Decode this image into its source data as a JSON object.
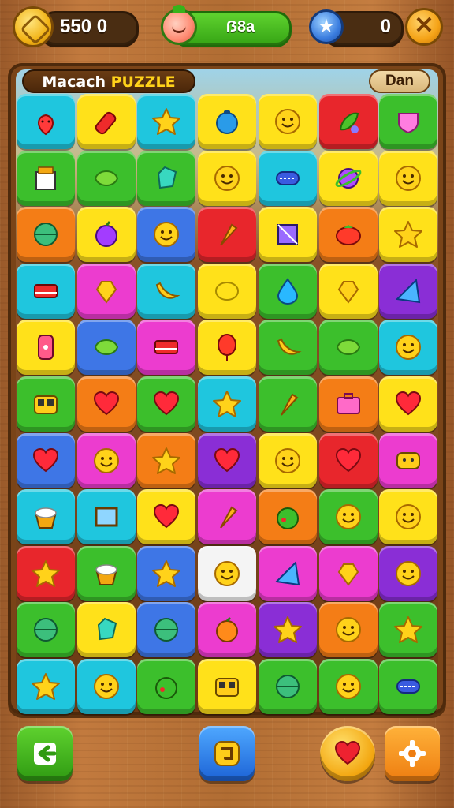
{
  "hud": {
    "coins_value": "550 0",
    "player_label": "ẞ8a",
    "stars_value": "0",
    "close_symbol": "✕",
    "icons": [
      "coin-icon",
      "fruit-avatar-icon",
      "star-icon",
      "close-icon"
    ]
  },
  "header": {
    "title_prefix": "Macach ",
    "title_accent": "PUZZLE",
    "level_label": "Dan"
  },
  "colors": {
    "red": "#e8262c",
    "orange": "#f47d16",
    "yellow": "#ffe11a",
    "green": "#3cbf2c",
    "teal": "#1fc6de",
    "blue": "#3e76e6",
    "purple": "#8a2ed6",
    "pink": "#ec3ccf",
    "white": "#f4f4f4"
  },
  "board": {
    "rows": [
      [
        [
          "teal",
          "strawberry"
        ],
        [
          "yellow",
          "bottle"
        ],
        [
          "teal",
          "star"
        ],
        [
          "yellow",
          "teapot"
        ],
        [
          "yellow",
          "smiley"
        ],
        [
          "red",
          "pepper"
        ],
        [
          "green",
          "shield"
        ]
      ],
      [
        [
          "green",
          "box"
        ],
        [
          "green",
          "leaf"
        ],
        [
          "green",
          "gem"
        ],
        [
          "yellow",
          "smiley"
        ],
        [
          "teal",
          "sandwich"
        ],
        [
          "yellow",
          "planet"
        ],
        [
          "yellow",
          "smiley"
        ]
      ],
      [
        [
          "orange",
          "ball"
        ],
        [
          "yellow",
          "berry"
        ],
        [
          "blue",
          "smiley"
        ],
        [
          "red",
          "carrot"
        ],
        [
          "yellow",
          "square-gem"
        ],
        [
          "orange",
          "tomato"
        ],
        [
          "yellow",
          "star"
        ]
      ],
      [
        [
          "teal",
          "book"
        ],
        [
          "pink",
          "heart-gem"
        ],
        [
          "teal",
          "banana"
        ],
        [
          "yellow",
          "lemon"
        ],
        [
          "green",
          "drop"
        ],
        [
          "yellow",
          "heart-gem"
        ],
        [
          "purple",
          "triangle-gem"
        ]
      ],
      [
        [
          "yellow",
          "phone"
        ],
        [
          "blue",
          "leaf"
        ],
        [
          "pink",
          "book"
        ],
        [
          "yellow",
          "balloon"
        ],
        [
          "green",
          "banana"
        ],
        [
          "green",
          "leaf"
        ],
        [
          "teal",
          "smiley"
        ]
      ],
      [
        [
          "green",
          "radio"
        ],
        [
          "orange",
          "heart"
        ],
        [
          "green",
          "heart"
        ],
        [
          "teal",
          "star"
        ],
        [
          "green",
          "carrot"
        ],
        [
          "orange",
          "suitcase"
        ],
        [
          "yellow",
          "heart"
        ]
      ],
      [
        [
          "blue",
          "heart"
        ],
        [
          "pink",
          "smiley"
        ],
        [
          "orange",
          "star"
        ],
        [
          "purple",
          "heart"
        ],
        [
          "yellow",
          "smiley"
        ],
        [
          "red",
          "heart"
        ],
        [
          "pink",
          "face-badge"
        ]
      ],
      [
        [
          "teal",
          "cake"
        ],
        [
          "teal",
          "frame"
        ],
        [
          "yellow",
          "heart"
        ],
        [
          "pink",
          "carrot"
        ],
        [
          "orange",
          "apple"
        ],
        [
          "green",
          "smiley"
        ],
        [
          "yellow",
          "smiley"
        ]
      ],
      [
        [
          "red",
          "star"
        ],
        [
          "green",
          "cake"
        ],
        [
          "blue",
          "star"
        ],
        [
          "white",
          "smiley"
        ],
        [
          "pink",
          "triangle-gem"
        ],
        [
          "pink",
          "heart-gem"
        ],
        [
          "purple",
          "smiley"
        ]
      ],
      [
        [
          "green",
          "ball"
        ],
        [
          "yellow",
          "gem"
        ],
        [
          "blue",
          "ball"
        ],
        [
          "pink",
          "orange"
        ],
        [
          "purple",
          "star"
        ],
        [
          "orange",
          "smiley"
        ],
        [
          "green",
          "star"
        ]
      ],
      [
        [
          "teal",
          "star"
        ],
        [
          "teal",
          "smiley"
        ],
        [
          "green",
          "apple"
        ],
        [
          "yellow",
          "radio"
        ],
        [
          "green",
          "ball"
        ],
        [
          "green",
          "smiley"
        ],
        [
          "green",
          "sandwich"
        ]
      ]
    ]
  },
  "bottom_bar": {
    "icons": [
      "exit-icon",
      "hint-icon",
      "heart-icon",
      "settings-icon"
    ]
  }
}
